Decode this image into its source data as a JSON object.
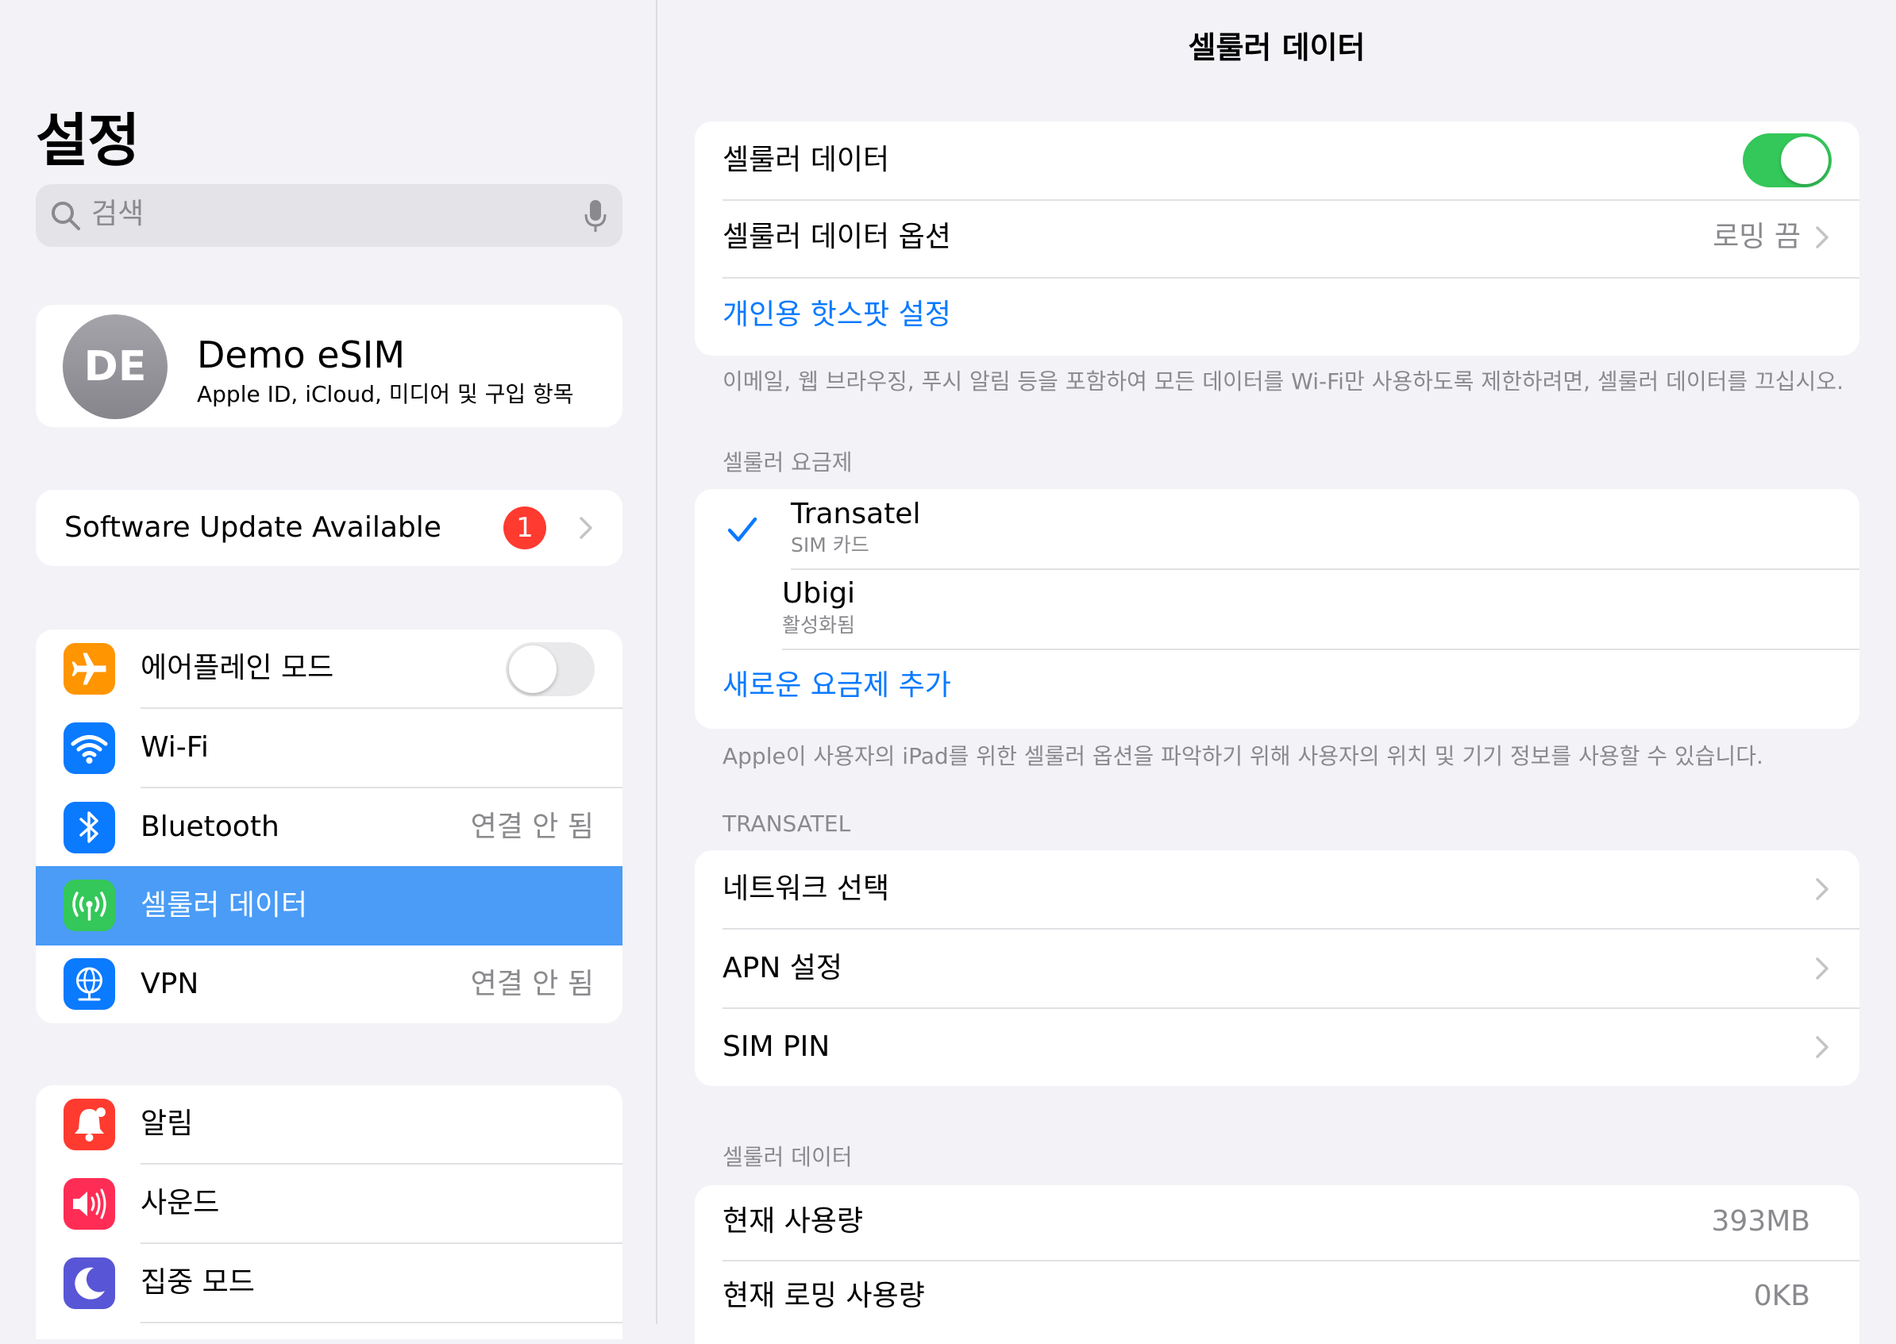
{
  "sidebar": {
    "title": "설정",
    "search": {
      "placeholder": "검색"
    },
    "profile": {
      "initials": "DE",
      "name": "Demo eSIM",
      "subtitle": "Apple ID, iCloud, 미디어 및 구입 항목"
    },
    "update": {
      "label": "Software Update Available",
      "badge": "1"
    },
    "group1": [
      {
        "label": "에어플레인 모드",
        "icon": "airplane-icon",
        "color": "#ff9500",
        "toggle": false
      },
      {
        "label": "Wi-Fi",
        "icon": "wifi-icon",
        "color": "#0a7aff",
        "value": ""
      },
      {
        "label": "Bluetooth",
        "icon": "bluetooth-icon",
        "color": "#0a7aff",
        "value": "연결 안 됨"
      },
      {
        "label": "셀룰러 데이터",
        "icon": "cellular-icon",
        "color": "#34c759",
        "selected": true
      },
      {
        "label": "VPN",
        "icon": "globe-icon",
        "color": "#0a7aff",
        "value": "연결 안 됨"
      }
    ],
    "group2": [
      {
        "label": "알림",
        "icon": "bell-icon",
        "color": "#ff3b30"
      },
      {
        "label": "사운드",
        "icon": "speaker-icon",
        "color": "#ff2d55"
      },
      {
        "label": "집중 모드",
        "icon": "moon-icon",
        "color": "#5856d6"
      }
    ]
  },
  "main": {
    "nav_title": "셀룰러 데이터",
    "card1": {
      "cellular_label": "셀룰러 데이터",
      "cellular_toggle": true,
      "options_label": "셀룰러 데이터 옵션",
      "options_value": "로밍 끔",
      "hotspot_label": "개인용 핫스팟 설정"
    },
    "footnote1": "이메일, 웹 브라우징, 푸시 알림 등을 포함하여 모든 데이터를 Wi-Fi만 사용하도록 제한하려면, 셀룰러 데이터를 끄십시오.",
    "plans": {
      "header": "셀룰러 요금제",
      "items": [
        {
          "name": "Transatel",
          "sub": "SIM 카드",
          "checked": true
        },
        {
          "name": "Ubigi",
          "sub": "활성화됨",
          "checked": false
        }
      ],
      "add_label": "새로운 요금제 추가"
    },
    "footnote2": "Apple이 사용자의 iPad를 위한 셀룰러 옵션을 파악하기 위해 사용자의 위치 및 기기 정보를 사용할 수 있습니다.",
    "transatel": {
      "header": "TRANSATEL",
      "items": [
        "네트워크 선택",
        "APN 설정",
        "SIM PIN"
      ]
    },
    "usage": {
      "header": "셀룰러 데이터",
      "items": [
        {
          "label": "현재 사용량",
          "value": "393MB"
        },
        {
          "label": "현재 로밍 사용량",
          "value": "0KB"
        }
      ]
    }
  },
  "colors": {
    "accent": "#0a7aff",
    "toggle_on": "#34c759",
    "selected_row": "#4a9cf6",
    "badge": "#ff3b30"
  }
}
